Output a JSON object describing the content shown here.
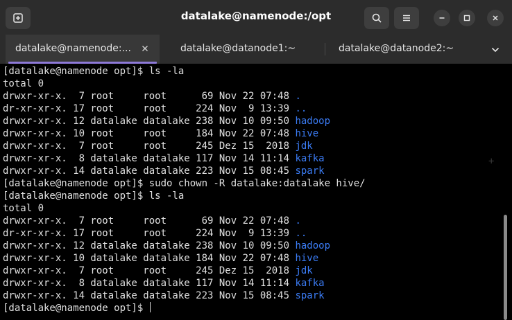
{
  "window": {
    "title": "datalake@namenode:/opt",
    "icons": {
      "new_tab": "new-tab-icon",
      "search": "search-icon",
      "menu": "hamburger-menu-icon",
      "minimize": "minimize-icon",
      "maximize": "maximize-icon",
      "close": "close-icon"
    }
  },
  "tabs": [
    {
      "label": "datalake@namenode:...",
      "active": true
    },
    {
      "label": "datalake@datanode1:~",
      "active": false
    },
    {
      "label": "datalake@datanode2:~",
      "active": false
    }
  ],
  "colors": {
    "directory": "#3b7cf5",
    "text": "#e0e0e0",
    "accent": "#8e7ad9",
    "background": "#000000"
  },
  "terminal": {
    "lines": [
      {
        "text": "[datalake@namenode opt]$ ls -la",
        "dir": ""
      },
      {
        "text": "total 0",
        "dir": ""
      },
      {
        "text": "drwxr-xr-x.  7 root     root      69 Nov 22 07:48 ",
        "dir": "."
      },
      {
        "text": "dr-xr-xr-x. 17 root     root     224 Nov  9 13:39 ",
        "dir": ".."
      },
      {
        "text": "drwxr-xr-x. 12 datalake datalake 238 Nov 10 09:50 ",
        "dir": "hadoop"
      },
      {
        "text": "drwxr-xr-x. 10 root     root     184 Nov 22 07:48 ",
        "dir": "hive"
      },
      {
        "text": "drwxr-xr-x.  7 root     root     245 Dez 15  2018 ",
        "dir": "jdk"
      },
      {
        "text": "drwxr-xr-x.  8 datalake datalake 117 Nov 14 11:14 ",
        "dir": "kafka"
      },
      {
        "text": "drwxr-xr-x. 14 datalake datalake 223 Nov 15 08:45 ",
        "dir": "spark"
      },
      {
        "text": "[datalake@namenode opt]$ sudo chown -R datalake:datalake hive/",
        "dir": ""
      },
      {
        "text": "[datalake@namenode opt]$ ls -la",
        "dir": ""
      },
      {
        "text": "total 0",
        "dir": ""
      },
      {
        "text": "drwxr-xr-x.  7 root     root      69 Nov 22 07:48 ",
        "dir": "."
      },
      {
        "text": "dr-xr-xr-x. 17 root     root     224 Nov  9 13:39 ",
        "dir": ".."
      },
      {
        "text": "drwxr-xr-x. 12 datalake datalake 238 Nov 10 09:50 ",
        "dir": "hadoop"
      },
      {
        "text": "drwxr-xr-x. 10 datalake datalake 184 Nov 22 07:48 ",
        "dir": "hive"
      },
      {
        "text": "drwxr-xr-x.  7 root     root     245 Dez 15  2018 ",
        "dir": "jdk"
      },
      {
        "text": "drwxr-xr-x.  8 datalake datalake 117 Nov 14 11:14 ",
        "dir": "kafka"
      },
      {
        "text": "drwxr-xr-x. 14 datalake datalake 223 Nov 15 08:45 ",
        "dir": "spark"
      }
    ],
    "prompt": "[datalake@namenode opt]$ "
  }
}
